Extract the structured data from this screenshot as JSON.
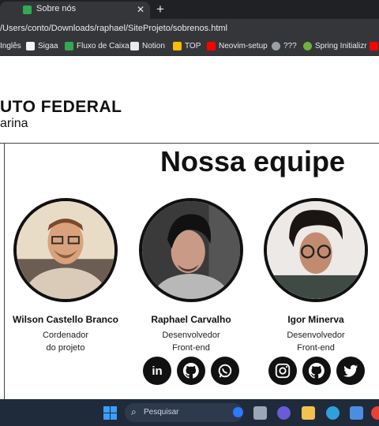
{
  "browser": {
    "tab_close_left": "✕",
    "tab_title": "Sobre nós",
    "tab_close": "✕",
    "new_tab": "+",
    "address": "/Users/conto/Downloads/raphael/SiteProjeto/sobrenos.html",
    "bookmarks": [
      {
        "label": "Inglês",
        "icon": "bookmark-icon",
        "color": "#8ab4f8"
      },
      {
        "label": "Sigaa",
        "icon": "sigaa-icon",
        "color": "#f1f3f4"
      },
      {
        "label": "Fluxo de Caixa",
        "icon": "sheets-icon",
        "color": "#34a853"
      },
      {
        "label": "Notion",
        "icon": "notion-icon",
        "color": "#e8eaed"
      },
      {
        "label": "TOP",
        "icon": "trophy-icon",
        "color": "#fbbc04"
      },
      {
        "label": "Neovim-setup",
        "icon": "youtube-icon",
        "color": "#ff0000"
      },
      {
        "label": "???",
        "icon": "unknown-icon",
        "color": "#9aa0a6"
      },
      {
        "label": "Spring Initializr",
        "icon": "spring-icon",
        "color": "#6db33f"
      }
    ]
  },
  "header": {
    "brand_line_1": "UTO FEDERAL",
    "brand_line_2": "arina"
  },
  "main": {
    "title": "Nossa equipe",
    "members": [
      {
        "name": "Wilson Castello Branco",
        "role_1": "Cordenador",
        "role_2": "do projeto"
      },
      {
        "name": "Raphael Carvalho",
        "role_1": "Desenvolvedor",
        "role_2": "Front-end"
      },
      {
        "name": "Igor Minerva",
        "role_1": "Desenvolvedor",
        "role_2": "Front-end"
      }
    ],
    "socials_raphael": [
      "linkedin-icon",
      "github-icon",
      "whatsapp-icon"
    ],
    "socials_igor": [
      "instagram-icon",
      "github-icon",
      "twitter-icon"
    ]
  },
  "taskbar": {
    "search_placeholder": "Pesquisar"
  }
}
